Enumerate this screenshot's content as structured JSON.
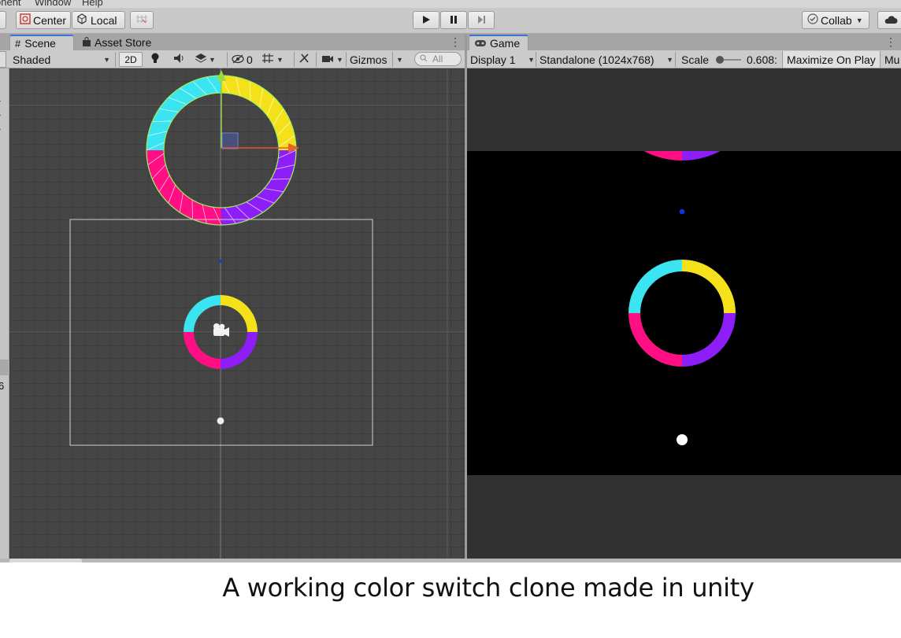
{
  "menubar": {
    "items": [
      "onent",
      "Window",
      "Help"
    ]
  },
  "toolbar": {
    "center_label": "Center",
    "local_label": "Local",
    "collab_label": "Collab"
  },
  "scene_panel": {
    "tab_scene": "Scene",
    "tab_asset_store": "Asset Store",
    "shading_mode": "Shaded",
    "mode_2d": "2D",
    "hidden_count": "0",
    "gizmos_label": "Gizmos",
    "search_placeholder": "All"
  },
  "game_panel": {
    "tab_game": "Game",
    "display": "Display 1",
    "resolution": "Standalone (1024x768)",
    "scale_label": "Scale",
    "scale_value": "0.608:",
    "maximize_label": "Maximize On Play",
    "mute_label": "Mu"
  },
  "ring_colors": {
    "cyan": "#3ae4f0",
    "yellow": "#f5e11a",
    "magenta": "#ff0f83",
    "purple": "#8d1ef8"
  },
  "left_sliver_text": "6",
  "caption": "A working color switch clone made in unity"
}
